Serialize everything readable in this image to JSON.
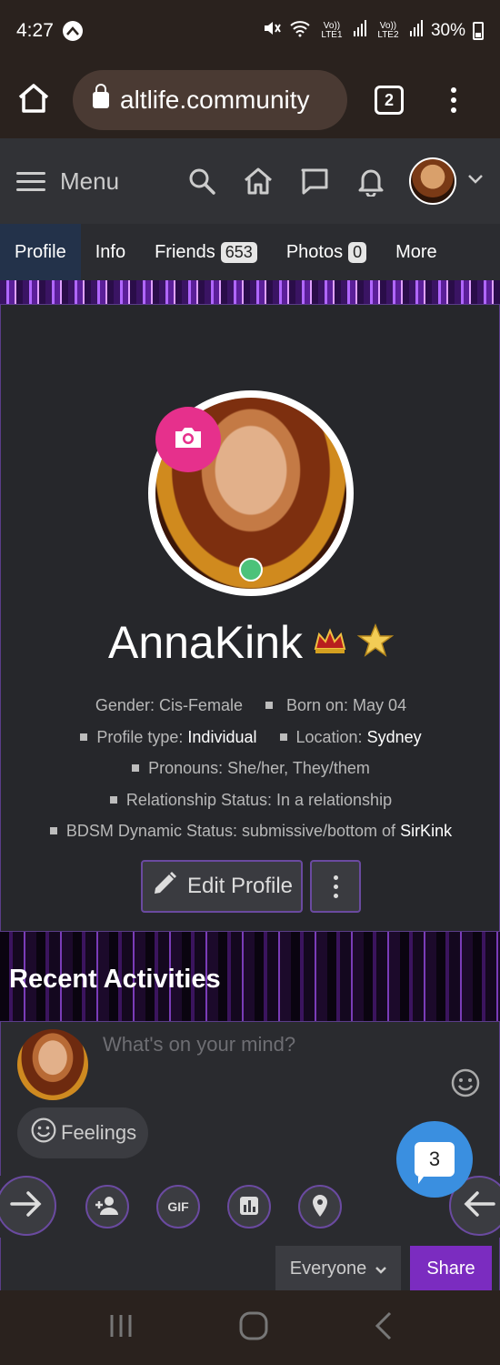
{
  "status_bar": {
    "time": "4:27",
    "battery": "30%",
    "net1": "Vo)) LTE1",
    "net2": "Vo)) LTE2"
  },
  "browser": {
    "url": "altlife.community",
    "tab_count": "2"
  },
  "header": {
    "menu_label": "Menu"
  },
  "profile_nav": {
    "tabs": [
      {
        "label": "Profile"
      },
      {
        "label": "Info"
      },
      {
        "label": "Friends",
        "count": "653"
      },
      {
        "label": "Photos",
        "count": "0"
      },
      {
        "label": "More"
      }
    ]
  },
  "profile": {
    "username": "AnnaKink",
    "gender": "Gender: Cis-Female",
    "born": "Born on: May 04",
    "profile_type_label": "Profile type:",
    "profile_type_value": "Individual",
    "location_label": "Location:",
    "location_value": "Sydney",
    "pronouns": "Pronouns: She/her, They/them",
    "relationship": "Relationship Status: In a relationship",
    "bdsm_label": "BDSM Dynamic Status: submissive/bottom of",
    "bdsm_value": "SirKink",
    "edit_label": "Edit Profile"
  },
  "activities": {
    "title": "Recent Activities",
    "placeholder": "What's on your mind?",
    "feelings_label": "Feelings",
    "gif_label": "GIF",
    "privacy_label": "Everyone",
    "share_label": "Share"
  },
  "chat": {
    "count": "3"
  },
  "colors": {
    "accent_purple": "#7b2cc0",
    "camera_pink": "#e6308c",
    "online_green": "#4cc27a",
    "chat_blue": "#3a8fe0"
  }
}
